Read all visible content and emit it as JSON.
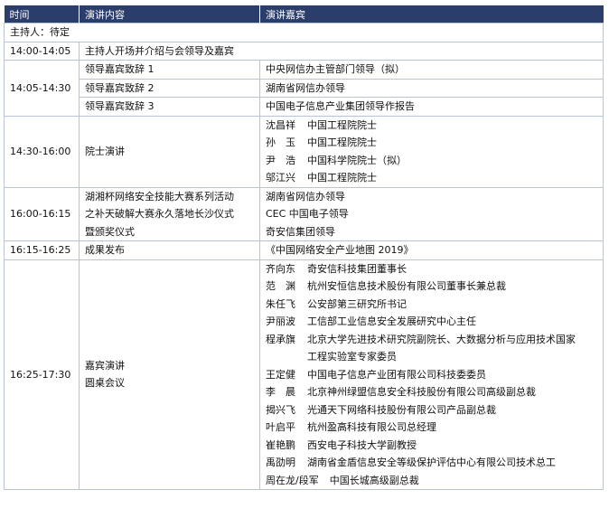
{
  "headers": [
    "时间",
    "演讲内容",
    "演讲嘉宾"
  ],
  "host_row": "主持人：待定",
  "rows": {
    "r1": {
      "time": "14:00-14:05",
      "content": "主持人开场并介绍与会领导及嘉宾"
    },
    "r2": {
      "time": "14:05-14:30",
      "items": [
        {
          "content": "领导嘉宾致辞 1",
          "guest": "中央网信办主管部门领导（拟）"
        },
        {
          "content": "领导嘉宾致辞 2",
          "guest": "湖南省网信办领导"
        },
        {
          "content": "领导嘉宾致辞 3",
          "guest": "中国电子信息产业集团领导作报告"
        }
      ]
    },
    "r3": {
      "time": "14:30-16:00",
      "content": "院士演讲",
      "guests": [
        {
          "name": "沈昌祥",
          "title": "中国工程院院士"
        },
        {
          "name": "孙　玉",
          "title": "中国工程院院士"
        },
        {
          "name": "尹　浩",
          "title": "中国科学院院士（拟）"
        },
        {
          "name": "邬江兴",
          "title": "中国工程院院士"
        }
      ]
    },
    "r4": {
      "time": "16:00-16:15",
      "content_lines": [
        "湖湘杯网络安全技能大赛系列活动",
        "之补天破解大赛永久落地长沙仪式",
        "暨颁奖仪式"
      ],
      "guests": [
        "湖南省网信办领导",
        "CEC 中国电子领导",
        "奇安信集团领导"
      ]
    },
    "r5": {
      "time": "16:15-16:25",
      "content": "成果发布",
      "guest": "《中国网络安全产业地图 2019》"
    },
    "r6": {
      "time": "16:25-17:30",
      "content_lines": [
        "嘉宾演讲",
        "圆桌会议"
      ],
      "guests": [
        {
          "name": "齐向东",
          "title": "奇安信科技集团董事长"
        },
        {
          "name": "范　渊",
          "title": "杭州安恒信息技术股份有限公司董事长兼总裁"
        },
        {
          "name": "朱任飞",
          "title": "公安部第三研究所书记"
        },
        {
          "name": "尹丽波",
          "title": "工信部工业信息安全发展研究中心主任"
        },
        {
          "name": "程承旗",
          "title": "北京大学先进技术研究院副院长、大数据分析与应用技术国家"
        },
        {
          "name": "",
          "title": "工程实验室专家委员"
        },
        {
          "name": "王定健",
          "title": "中国电子信息产业团有限公司科技委委员"
        },
        {
          "name": "李　晨",
          "title": "北京神州绿盟信息安全科技股份有限公司高级副总裁"
        },
        {
          "name": "揭兴飞",
          "title": "光通天下网络科技股份有限公司产品副总裁"
        },
        {
          "name": "叶启平",
          "title": "杭州盈高科技有限公司总经理"
        },
        {
          "name": "崔艳鹏",
          "title": "西安电子科技大学副教授"
        },
        {
          "name": "禹劭明",
          "title": "湖南省金盾信息安全等级保护评估中心有限公司技术总工"
        },
        {
          "name": "周在龙/段军",
          "title": "中国长城高级副总裁"
        }
      ]
    }
  }
}
